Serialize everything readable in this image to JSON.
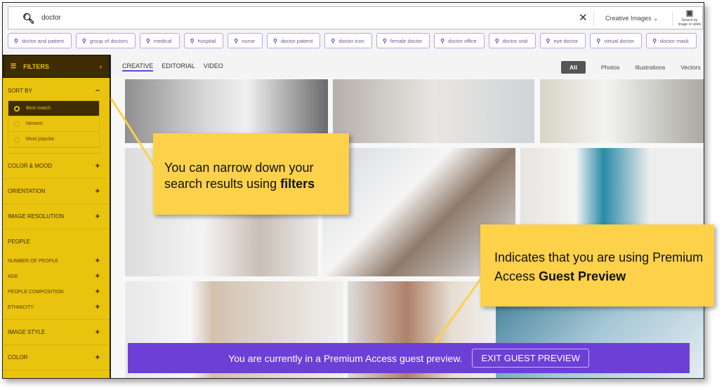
{
  "search": {
    "query": "doctor",
    "scope": "Creative Images",
    "search_by_image": "Search by image or video"
  },
  "chips": [
    "doctor and patient",
    "group of doctors",
    "medical",
    "hospital",
    "nurse",
    "doctor patient",
    "doctor icon",
    "female doctor",
    "doctor office",
    "doctor visit",
    "eye doctor",
    "virtual doctor",
    "doctor mask"
  ],
  "sidebar": {
    "title": "FILTERS",
    "sort_by": "SORT BY",
    "sort_options": [
      "Best match",
      "Newest",
      "Most popular"
    ],
    "selected_sort": "Best match",
    "sections": [
      "COLOR & MOOD",
      "ORIENTATION",
      "IMAGE RESOLUTION"
    ],
    "people": "PEOPLE",
    "people_items": [
      "NUMBER OF PEOPLE",
      "AGE",
      "PEOPLE COMPOSITION",
      "ETHNICITY"
    ],
    "sections2": [
      "IMAGE STYLE",
      "COLOR"
    ]
  },
  "tabs": [
    "CREATIVE",
    "EDITORIAL",
    "VIDEO"
  ],
  "active_tab": "CREATIVE",
  "types": [
    "All",
    "Photos",
    "Illustrations",
    "Vectors"
  ],
  "active_type": "All",
  "callouts": {
    "filters_pre": "You can narrow down your search results using ",
    "filters_bold": "filters",
    "guest_pre": "Indicates that you are using Premium Access ",
    "guest_bold": "Guest Preview"
  },
  "banner": {
    "text": "You are currently in a Premium Access guest preview.",
    "button": "EXIT GUEST PREVIEW"
  },
  "colors": {
    "accent": "#6c3fd6",
    "sidebar": "#e9c30d",
    "callout": "#fdd14a"
  }
}
